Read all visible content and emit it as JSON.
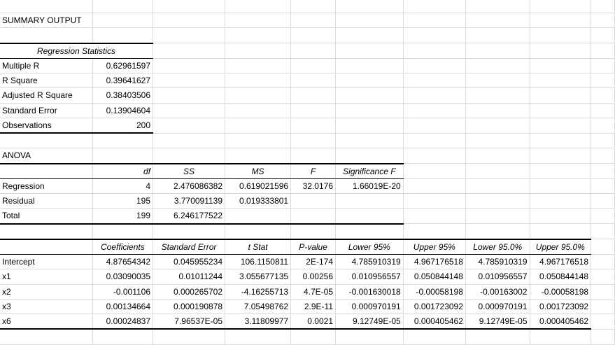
{
  "summary_title": "SUMMARY OUTPUT",
  "regression_statistics": {
    "header": "Regression Statistics",
    "rows": [
      {
        "label": "Multiple R",
        "value": "0.62961597"
      },
      {
        "label": "R Square",
        "value": "0.39641627"
      },
      {
        "label": "Adjusted R Square",
        "value": "0.38403506"
      },
      {
        "label": "Standard Error",
        "value": "0.13904604"
      },
      {
        "label": "Observations",
        "value": "200"
      }
    ]
  },
  "anova": {
    "title": "ANOVA",
    "headers": [
      "df",
      "SS",
      "MS",
      "F",
      "Significance F"
    ],
    "rows": [
      {
        "label": "Regression",
        "cells": [
          "4",
          "2.476086382",
          "0.619021596",
          "32.0176",
          "1.66019E-20"
        ]
      },
      {
        "label": "Residual",
        "cells": [
          "195",
          "3.770091139",
          "0.019333801",
          "",
          ""
        ]
      },
      {
        "label": "Total",
        "cells": [
          "199",
          "6.246177522",
          "",
          "",
          ""
        ]
      }
    ]
  },
  "coefficients": {
    "headers": [
      "Coefficients",
      "Standard Error",
      "t Stat",
      "P-value",
      "Lower 95%",
      "Upper 95%",
      "Lower 95.0%",
      "Upper 95.0%"
    ],
    "rows": [
      {
        "label": "Intercept",
        "cells": [
          "4.87654342",
          "0.045955234",
          "106.1150811",
          "2E-174",
          "4.785910319",
          "4.967176518",
          "4.785910319",
          "4.967176518"
        ]
      },
      {
        "label": "x1",
        "cells": [
          "0.03090035",
          "0.01011244",
          "3.055677135",
          "0.00256",
          "0.010956557",
          "0.050844148",
          "0.010956557",
          "0.050844148"
        ]
      },
      {
        "label": "x2",
        "cells": [
          "-0.001106",
          "0.000265702",
          "-4.16255713",
          "4.7E-05",
          "-0.001630018",
          "-0.00058198",
          "-0.00163002",
          "-0.00058198"
        ]
      },
      {
        "label": "x3",
        "cells": [
          "0.00134664",
          "0.000190878",
          "7.05498762",
          "2.9E-11",
          "0.000970191",
          "0.001723092",
          "0.000970191",
          "0.001723092"
        ]
      },
      {
        "label": "x6",
        "cells": [
          "0.00024837",
          "7.96537E-05",
          "3.11809977",
          "0.0021",
          "9.12749E-05",
          "0.000405462",
          "9.12749E-05",
          "0.000405462"
        ]
      }
    ]
  }
}
